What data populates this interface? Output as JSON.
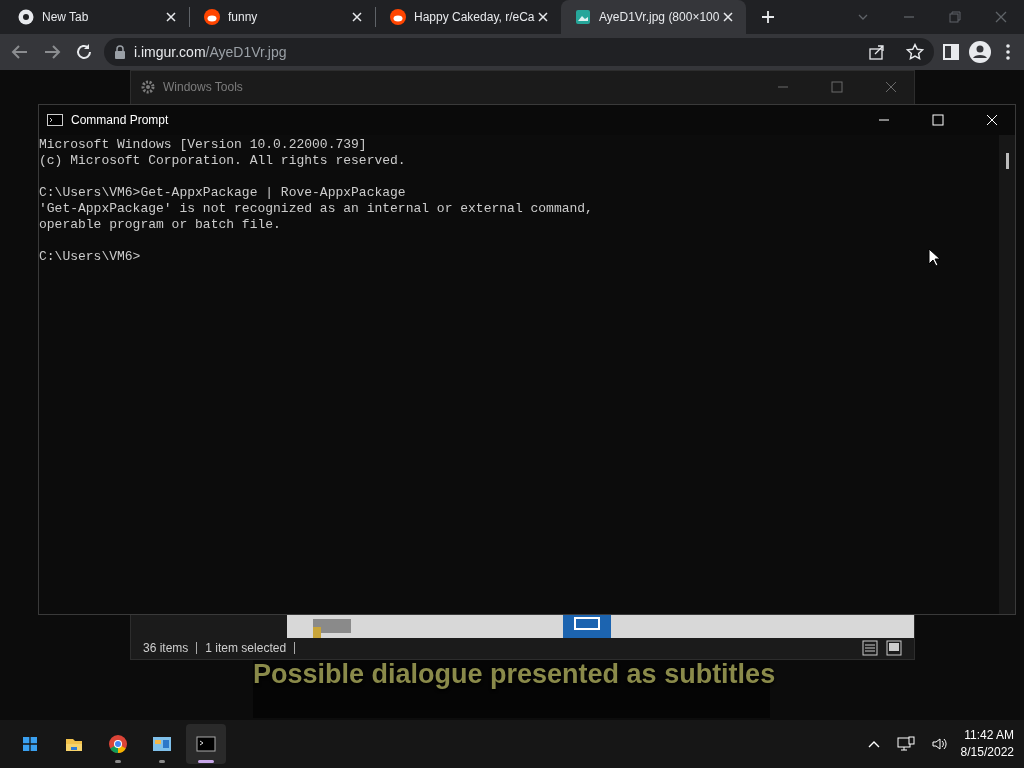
{
  "browser": {
    "tabs": [
      {
        "title": "New Tab",
        "kind": "chrome",
        "selected": false
      },
      {
        "title": "funny",
        "kind": "reddit",
        "selected": false
      },
      {
        "title": "Happy Cakeday, r/eCa",
        "kind": "reddit",
        "selected": false
      },
      {
        "title": "AyeD1Vr.jpg (800×100",
        "kind": "image",
        "selected": true
      }
    ],
    "address": {
      "host": "i.imgur.com",
      "path": "/AyeD1Vr.jpg"
    }
  },
  "desktop": {
    "back_window": {
      "title": "Windows Tools",
      "status_bar": [
        "36 items",
        "1 item selected"
      ]
    },
    "cmd_window": {
      "title": "Command Prompt",
      "blocks": [
        [
          "Microsoft Windows [Version 10.0.22000.739]",
          "(c) Microsoft Corporation. All rights reserved."
        ],
        [
          "C:\\Users\\VM6>Get-AppxPackage | Rove-AppxPackage",
          "'Get-AppxPackage' is not recognized as an internal or external command,",
          "operable program or batch file."
        ],
        [
          "C:\\Users\\VM6>"
        ]
      ]
    },
    "subtitle": "Possible dialogue presented as subtitles",
    "taskbar": {
      "apps": [
        {
          "kind": "start",
          "running": false,
          "active": false
        },
        {
          "kind": "explorer",
          "running": false,
          "active": false
        },
        {
          "kind": "chrome",
          "running": true,
          "active": false
        },
        {
          "kind": "tools",
          "running": true,
          "active": false
        },
        {
          "kind": "cmd",
          "running": true,
          "active": true
        }
      ],
      "time": "11:42 AM",
      "date": "8/15/2022"
    }
  }
}
